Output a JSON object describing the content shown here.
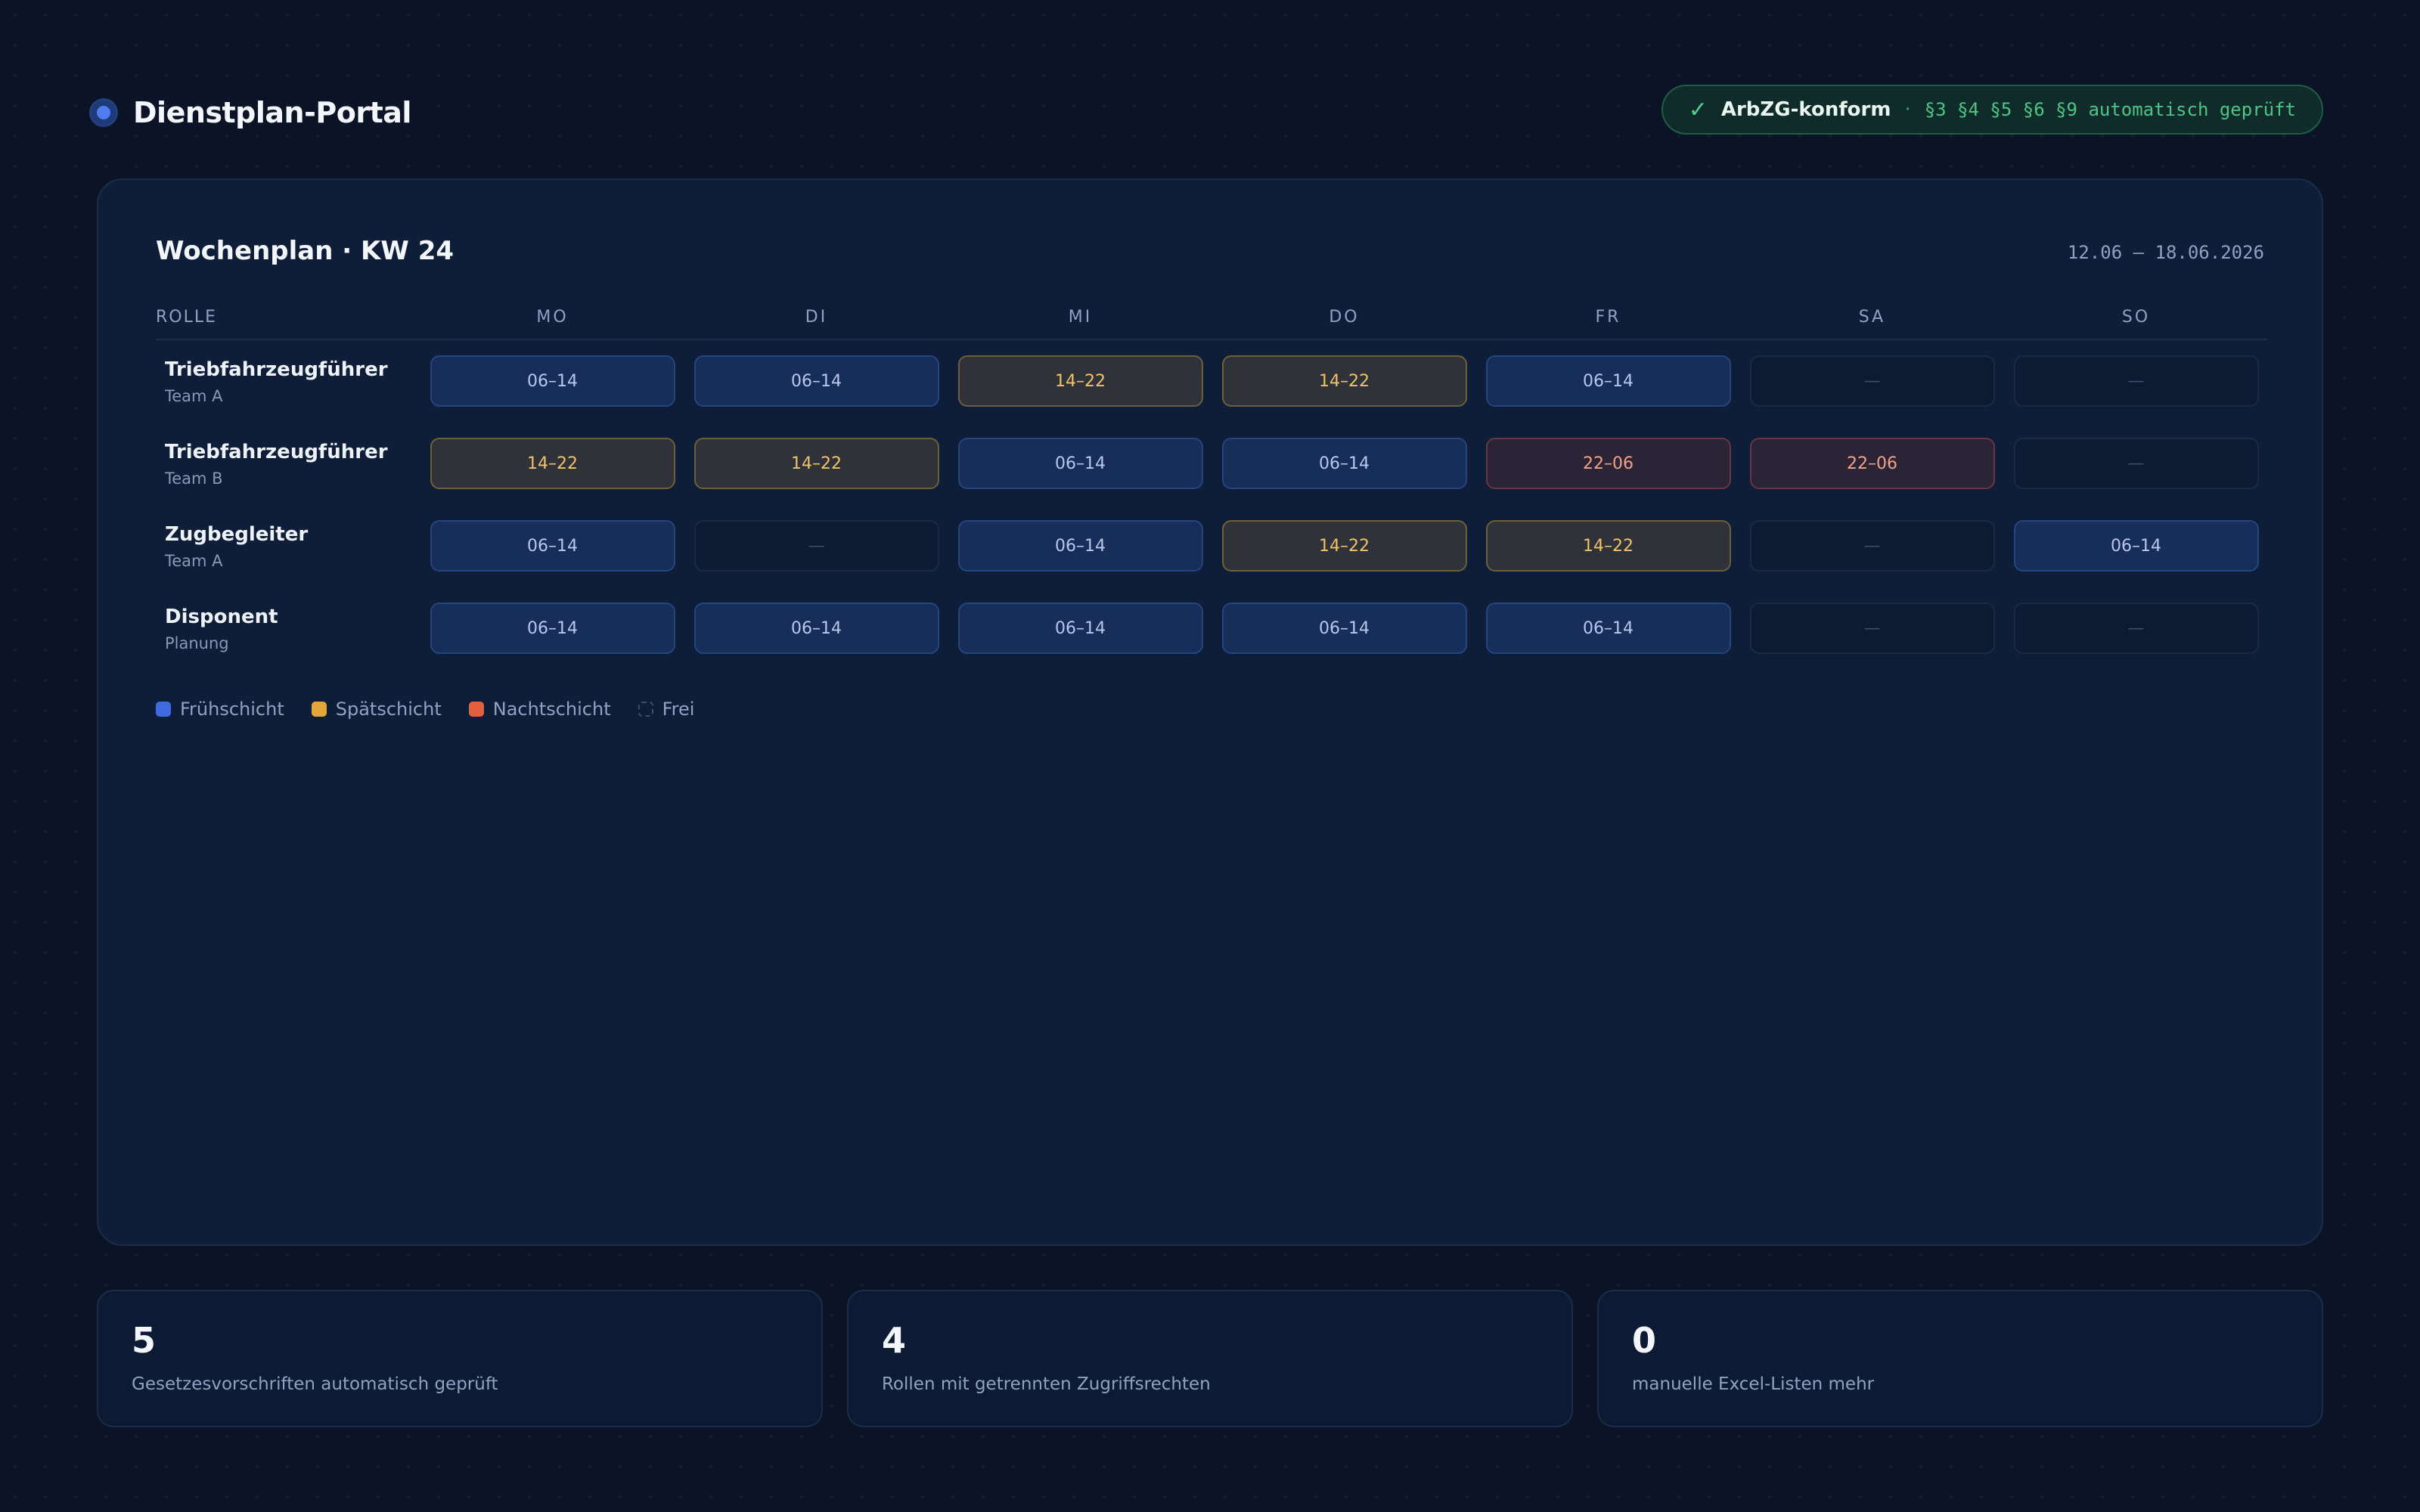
{
  "header": {
    "title": "Dienstplan-Portal",
    "compliance": {
      "check": "✓",
      "label": "ArbZG-konform",
      "separator": "·",
      "detail": "§3 §4 §5 §6 §9 automatisch geprüft"
    }
  },
  "plan": {
    "title": "Wochenplan · KW 24",
    "range": "12.06 – 18.06.2026",
    "role_header": "ROLLE",
    "days": [
      "MO",
      "DI",
      "MI",
      "DO",
      "FR",
      "SA",
      "SO"
    ],
    "rows": [
      {
        "role": "Triebfahrzeugführer",
        "team": "Team A",
        "shifts": [
          {
            "type": "early",
            "label": "06–14"
          },
          {
            "type": "early",
            "label": "06–14"
          },
          {
            "type": "late",
            "label": "14–22"
          },
          {
            "type": "late",
            "label": "14–22"
          },
          {
            "type": "early",
            "label": "06–14"
          },
          {
            "type": "free",
            "label": "—"
          },
          {
            "type": "free",
            "label": "—"
          }
        ]
      },
      {
        "role": "Triebfahrzeugführer",
        "team": "Team B",
        "shifts": [
          {
            "type": "late",
            "label": "14–22"
          },
          {
            "type": "late",
            "label": "14–22"
          },
          {
            "type": "early",
            "label": "06–14"
          },
          {
            "type": "early",
            "label": "06–14"
          },
          {
            "type": "night",
            "label": "22–06"
          },
          {
            "type": "night",
            "label": "22–06"
          },
          {
            "type": "free",
            "label": "—"
          }
        ]
      },
      {
        "role": "Zugbegleiter",
        "team": "Team A",
        "shifts": [
          {
            "type": "early",
            "label": "06–14"
          },
          {
            "type": "free",
            "label": "—"
          },
          {
            "type": "early",
            "label": "06–14"
          },
          {
            "type": "late",
            "label": "14–22"
          },
          {
            "type": "late",
            "label": "14–22"
          },
          {
            "type": "free",
            "label": "—"
          },
          {
            "type": "early",
            "label": "06–14"
          }
        ]
      },
      {
        "role": "Disponent",
        "team": "Planung",
        "shifts": [
          {
            "type": "early",
            "label": "06–14"
          },
          {
            "type": "early",
            "label": "06–14"
          },
          {
            "type": "early",
            "label": "06–14"
          },
          {
            "type": "early",
            "label": "06–14"
          },
          {
            "type": "early",
            "label": "06–14"
          },
          {
            "type": "free",
            "label": "—"
          },
          {
            "type": "free",
            "label": "—"
          }
        ]
      }
    ],
    "legend": [
      {
        "key": "early",
        "label": "Frühschicht",
        "color": "#3f6be0"
      },
      {
        "key": "late",
        "label": "Spätschicht",
        "color": "#e3a63a"
      },
      {
        "key": "night",
        "label": "Nachtschicht",
        "color": "#e2603e"
      },
      {
        "key": "free",
        "label": "Frei"
      }
    ]
  },
  "stats": [
    {
      "value": "5",
      "label": "Gesetzesvorschriften automatisch geprüft"
    },
    {
      "value": "4",
      "label": "Rollen mit getrennten Zugriffsrechten"
    },
    {
      "value": "0",
      "label": "manuelle Excel-Listen mehr"
    }
  ]
}
